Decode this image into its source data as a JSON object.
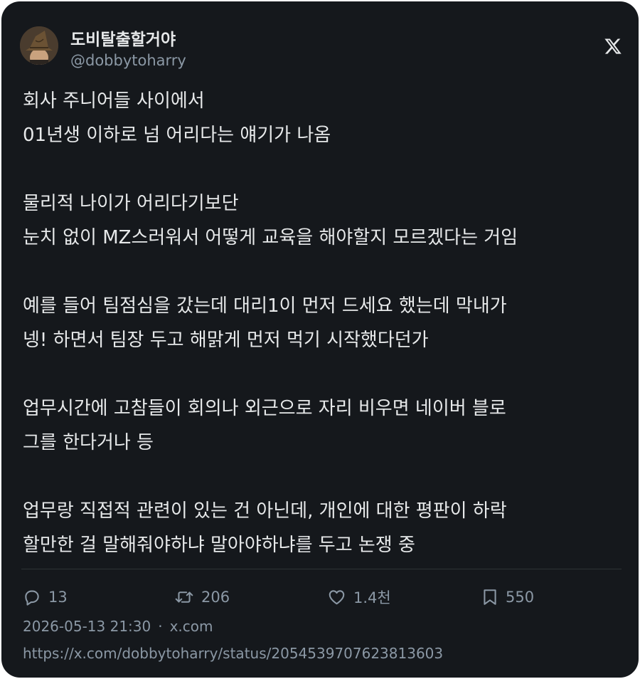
{
  "user": {
    "display_name": "도비탈출할거야",
    "handle": "@dobbytoharry"
  },
  "tweet": {
    "lines": [
      "회사 주니어들 사이에서",
      "01년생 이하로 넘 어리다는 얘기가 나옴",
      "",
      "물리적 나이가 어리다기보단",
      "눈치 없이 MZ스러워서 어떻게 교육을 해야할지 모르겠다는 거임",
      "",
      "예를 들어 팀점심을 갔는데 대리1이 먼저 드세요 했는데 막내가",
      "넹! 하면서 팀장 두고 해맑게 먼저 먹기 시작했다던가",
      "",
      "업무시간에 고참들이 회의나 외근으로 자리 비우면 네이버 블로",
      "그를 한다거나 등",
      "",
      "업무랑 직접적 관련이 있는 건 아닌데, 개인에 대한 평판이 하락",
      "할만한 걸 말해줘야하냐 말아야하냐를 두고 논쟁 중"
    ]
  },
  "stats": {
    "replies": "13",
    "retweets": "206",
    "likes": "1.4천",
    "bookmarks": "550"
  },
  "meta": {
    "datetime": "2026-05-13 21:30",
    "separator": "·",
    "source": "x.com",
    "url": "https://x.com/dobbytoharry/status/2054539707623813603"
  },
  "icons": {
    "reply": "speech-bubble-icon",
    "retweet": "retweet-arrows-icon",
    "like": "heart-icon",
    "bookmark": "bookmark-icon",
    "brand": "x-logo-icon"
  },
  "colors": {
    "background": "#15181c",
    "text": "#e7e9ea",
    "muted": "#8b98a5",
    "divider": "#2f3336"
  }
}
